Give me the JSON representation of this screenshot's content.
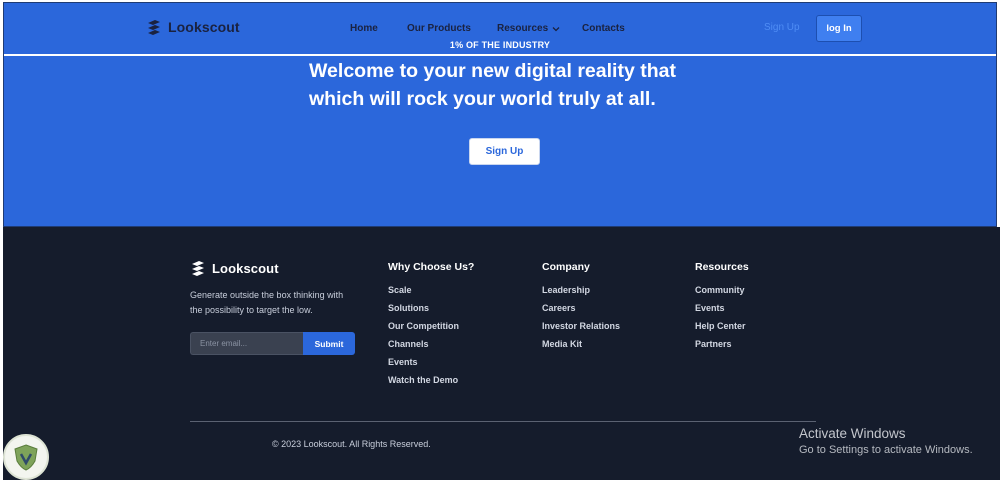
{
  "brand": {
    "name": "Lookscout"
  },
  "nav": {
    "items": [
      "Home",
      "Our Products",
      "Resources",
      "Contacts"
    ],
    "signup_label": "Sign Up",
    "login_label": "log In",
    "tagline": "1% OF THE INDUSTRY"
  },
  "hero": {
    "title_line1": "Welcome to your new digital reality that",
    "title_line2": "which will rock your world truly at all.",
    "cta_label": "Sign Up"
  },
  "footer": {
    "brand_name": "Lookscout",
    "description_line1": "Generate outside the box thinking with",
    "description_line2": "the possibility to target the low.",
    "email_placeholder": "Enter email...",
    "submit_label": "Submit",
    "columns": [
      {
        "title": "Why Choose Us?",
        "links": [
          "Scale",
          "Solutions",
          "Our Competition",
          "Channels",
          "Events",
          "Watch the Demo"
        ]
      },
      {
        "title": "Company",
        "links": [
          "Leadership",
          "Careers",
          "Investor Relations",
          "Media Kit"
        ]
      },
      {
        "title": "Resources",
        "links": [
          "Community",
          "Events",
          "Help Center",
          "Partners"
        ]
      }
    ],
    "copyright": "© 2023 Lookscout. All Rights Reserved."
  },
  "overlay": {
    "activate_title": "Activate Windows",
    "activate_sub": "Go to Settings to activate Windows."
  },
  "colors": {
    "primary": "#2b67db",
    "footer_bg": "#151c2c",
    "dark_text": "#1a2240"
  },
  "icons": [
    "lookscout-logo-icon",
    "chevron-down-icon",
    "shield-badge-icon"
  ]
}
